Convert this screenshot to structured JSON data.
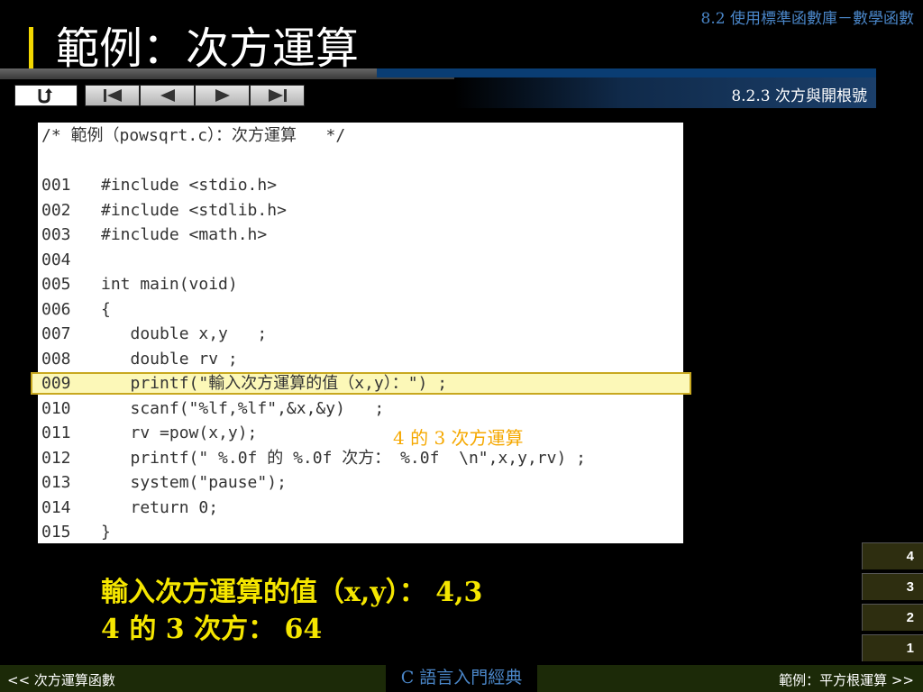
{
  "header": {
    "chapter": "8.2  使用標準函數庫－數學函數",
    "title": "範例：次方運算",
    "subsection": "8.2.3 次方與開根號"
  },
  "nav": {
    "buttons": [
      "home-icon",
      "first-page-icon",
      "previous-icon",
      "next-icon",
      "last-page-icon"
    ]
  },
  "code": {
    "header_comment": "/* 範例（powsqrt.c）：次方運算   */",
    "lines": [
      {
        "num": "001",
        "text": "#include <stdio.h>"
      },
      {
        "num": "002",
        "text": "#include <stdlib.h>"
      },
      {
        "num": "003",
        "text": "#include <math.h>"
      },
      {
        "num": "004",
        "text": ""
      },
      {
        "num": "005",
        "text": "int main(void)"
      },
      {
        "num": "006",
        "text": "{"
      },
      {
        "num": "007",
        "text": "   double x,y   ;"
      },
      {
        "num": "008",
        "text": "   double rv ;"
      },
      {
        "num": "009",
        "text": "   printf(\"輸入次方運算的值（x,y）：\") ;"
      },
      {
        "num": "010",
        "text": "   scanf(\"%lf,%lf\",&x,&y)   ;"
      },
      {
        "num": "011",
        "text": "   rv =pow(x,y);"
      },
      {
        "num": "012",
        "text": "   printf(\" %.0f 的 %.0f 次方： %.0f  \\n\",x,y,rv) ;"
      },
      {
        "num": "013",
        "text": "   system(\"pause\");"
      },
      {
        "num": "014",
        "text": "   return 0;"
      },
      {
        "num": "015",
        "text": "}"
      }
    ]
  },
  "annotation": "4 的 3 次方運算",
  "output": {
    "line1": "輸入次方運算的值（x,y）： 4,3",
    "line2": "4 的 3 次方： 64"
  },
  "pages": [
    "4",
    "3",
    "2",
    "1"
  ],
  "footer": {
    "prev": "<< 次方運算函數",
    "book": "C 語言入門經典",
    "next": "範例：平方根運算 >>"
  },
  "colors": {
    "accent_yellow": "#f2d700",
    "output_yellow": "#f5e600",
    "annotation_orange": "#f5a800",
    "link_blue": "#4a86c8"
  }
}
